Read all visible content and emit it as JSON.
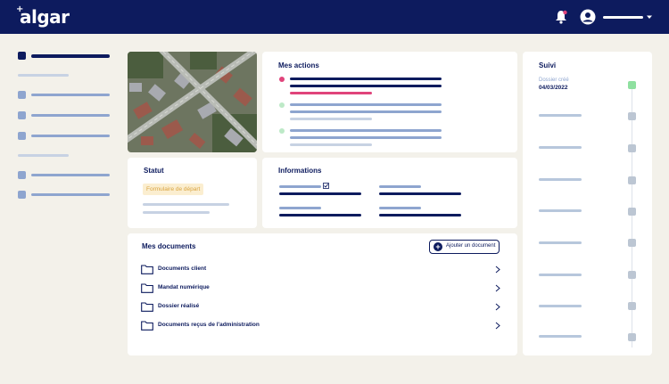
{
  "header": {
    "logo_text": "algar",
    "logo_mark": "+"
  },
  "actions": {
    "title": "Mes actions"
  },
  "status": {
    "title": "Statut",
    "badge": "Formulaire de départ"
  },
  "informations": {
    "title": "Informations"
  },
  "documents": {
    "title": "Mes documents",
    "add_button": "Ajouter un document",
    "items": [
      {
        "label": "Documents client"
      },
      {
        "label": "Mandat numérique"
      },
      {
        "label": "Dossier réalisé"
      },
      {
        "label": "Documents reçus de l'administration"
      }
    ]
  },
  "suivi": {
    "title": "Suivi",
    "created_label": "Dossier créé",
    "created_date": "04/03/2022"
  },
  "colors": {
    "navy": "#0d1b5e",
    "accent_pink": "#e0447b",
    "success_green": "#8fe0a0",
    "badge_bg": "#fbeed0",
    "badge_text": "#d9a441"
  },
  "icons": [
    "bell-icon",
    "user-avatar-icon",
    "chevron-down-icon",
    "plus-icon",
    "folder-icon",
    "chevron-right-icon",
    "check-icon",
    "alert-icon"
  ]
}
